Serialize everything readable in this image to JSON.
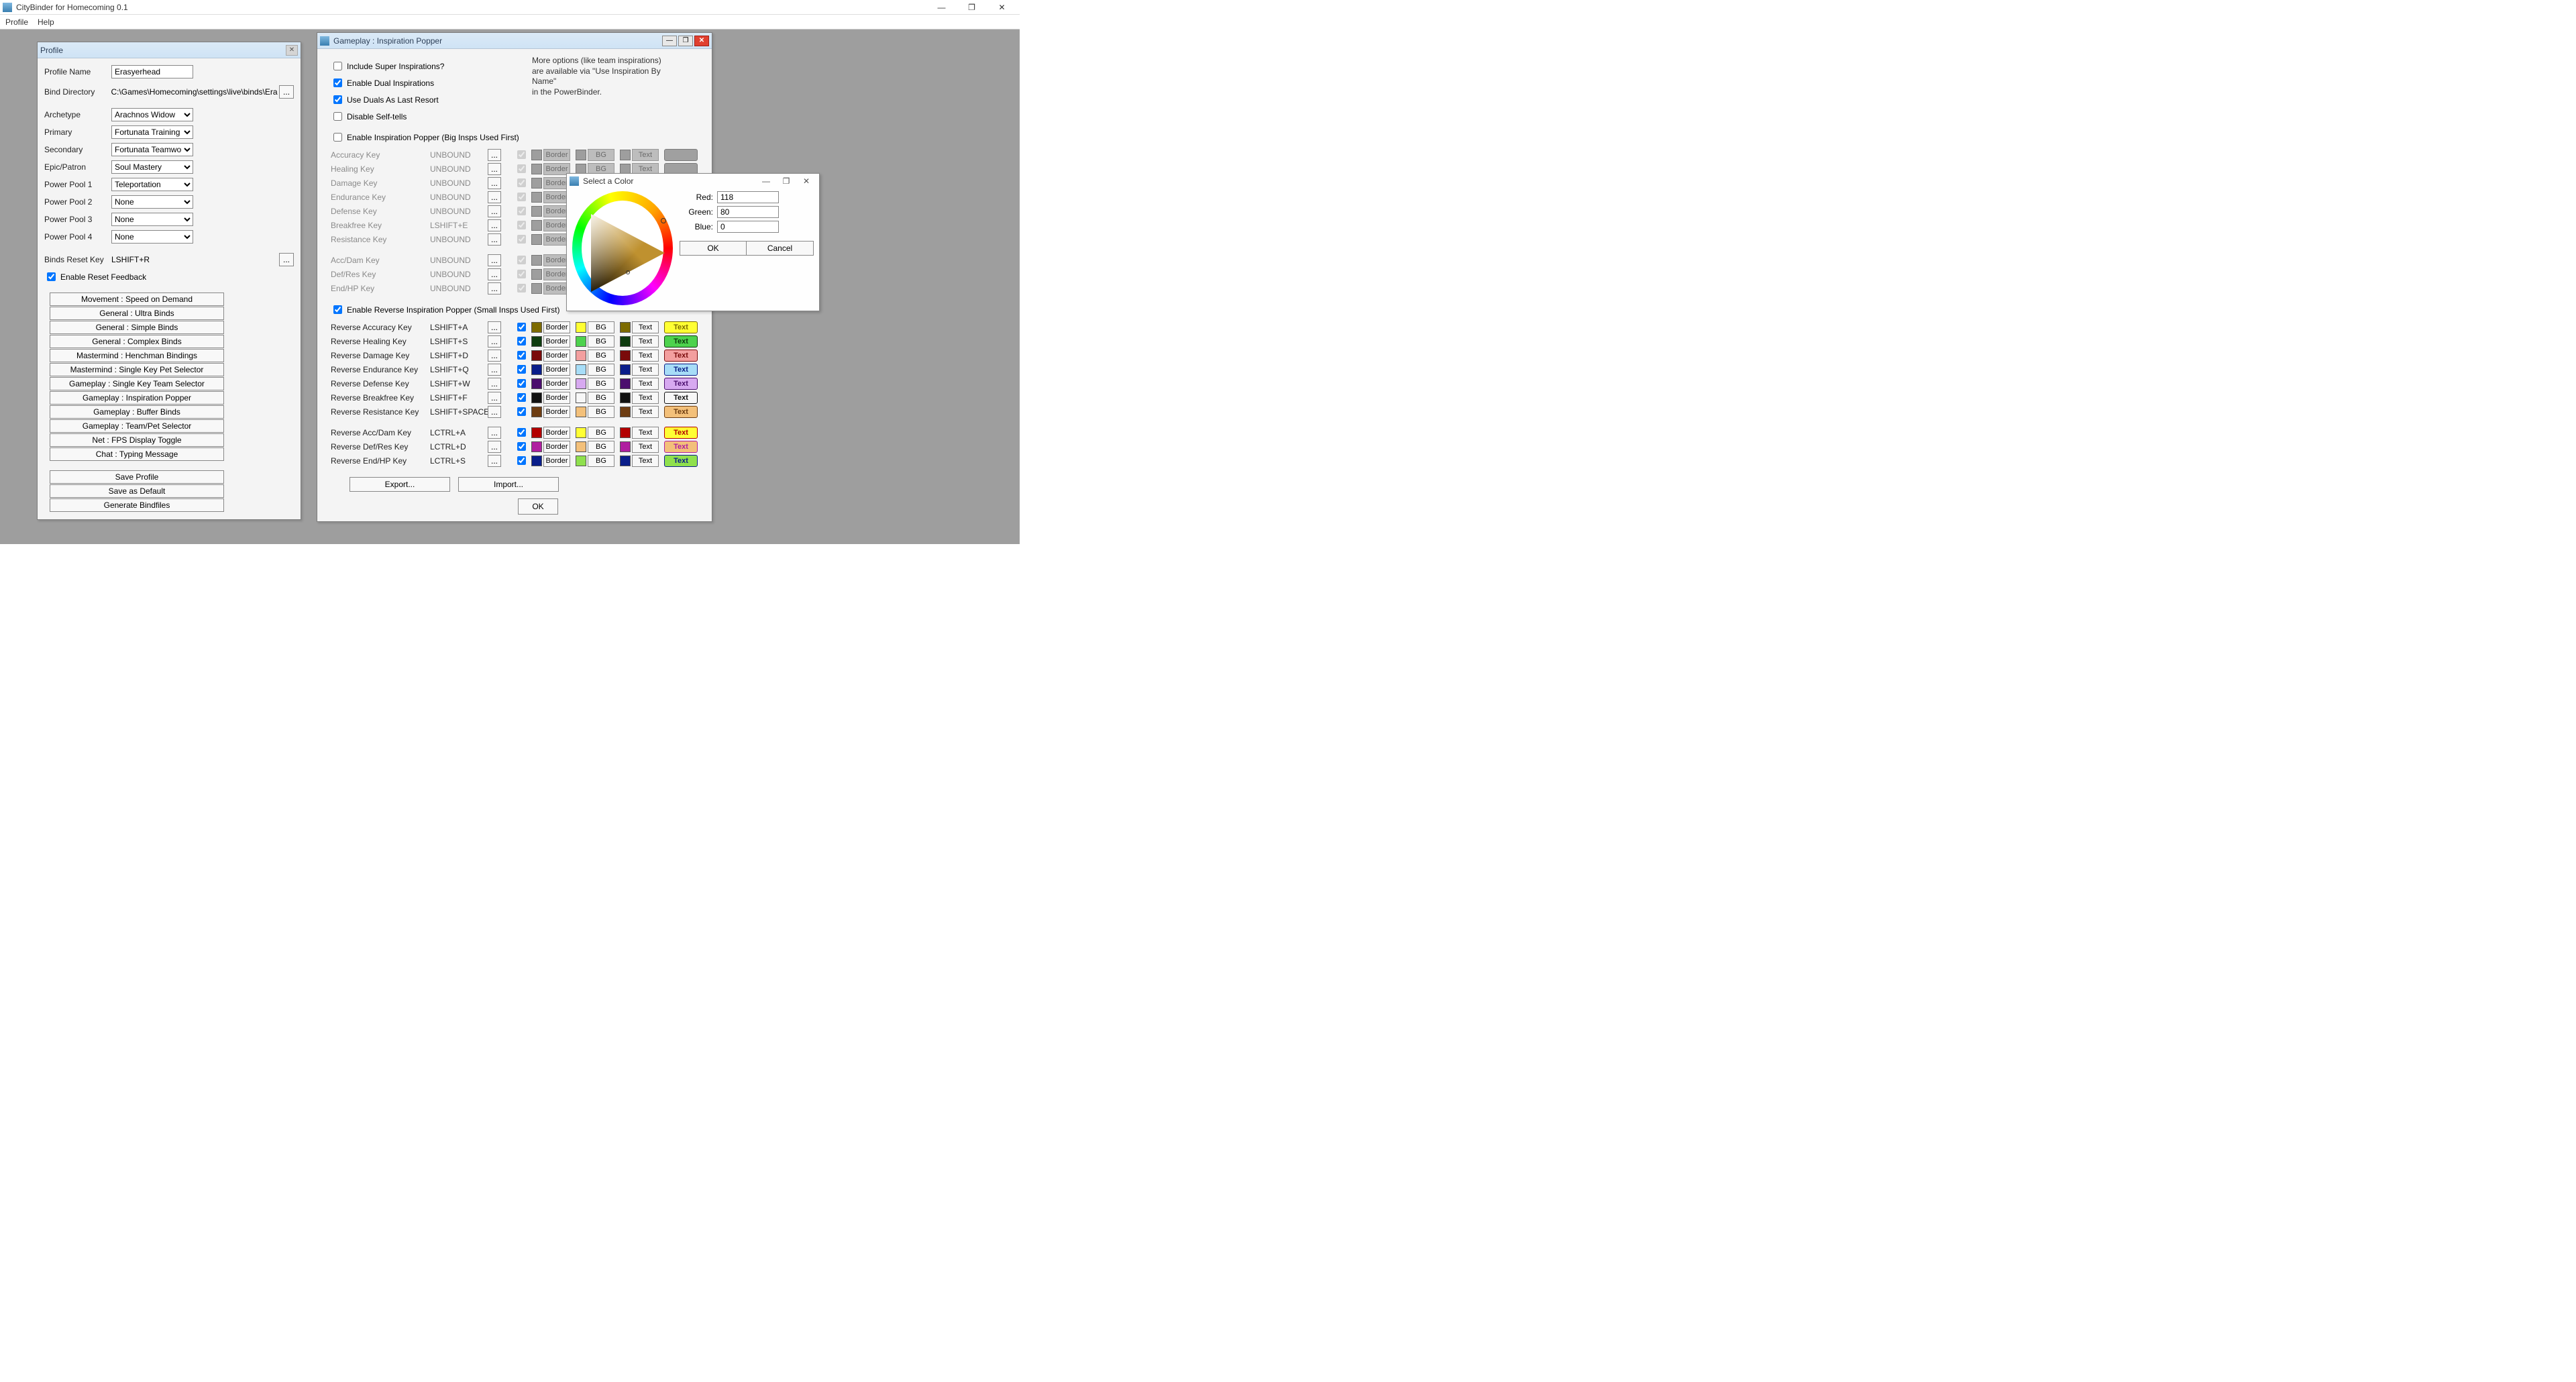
{
  "app": {
    "title": "CityBinder for Homecoming 0.1",
    "menu": [
      "Profile",
      "Help"
    ],
    "win_min": "—",
    "win_max": "❐",
    "win_close": "✕"
  },
  "profile": {
    "title": "Profile",
    "name_label": "Profile Name",
    "name_value": "Erasyerhead",
    "binddir_label": "Bind Directory",
    "binddir_value": "C:\\Games\\Homecoming\\settings\\live\\binds\\Erasyer",
    "ellipsis": "...",
    "dropdowns": [
      {
        "label": "Archetype",
        "value": "Arachnos Widow"
      },
      {
        "label": "Primary",
        "value": "Fortunata Training"
      },
      {
        "label": "Secondary",
        "value": "Fortunata Teamwork"
      },
      {
        "label": "Epic/Patron",
        "value": "Soul Mastery"
      },
      {
        "label": "Power Pool 1",
        "value": "Teleportation"
      },
      {
        "label": "Power Pool 2",
        "value": "None"
      },
      {
        "label": "Power Pool 3",
        "value": "None"
      },
      {
        "label": "Power Pool 4",
        "value": "None"
      }
    ],
    "reset_label": "Binds Reset Key",
    "reset_val": "LSHIFT+R",
    "reset_fb": "Enable Reset Feedback",
    "modules": [
      "Movement : Speed on Demand",
      "General : Ultra Binds",
      "General : Simple Binds",
      "General : Complex Binds",
      "Mastermind : Henchman Bindings",
      "Mastermind : Single Key Pet Selector",
      "Gameplay : Single Key Team Selector",
      "Gameplay : Inspiration Popper",
      "Gameplay : Buffer Binds",
      "Gameplay : Team/Pet Selector",
      "Net : FPS Display Toggle",
      "Chat : Typing Message"
    ],
    "actions": [
      "Save Profile",
      "Save as Default",
      "Generate Bindfiles"
    ]
  },
  "gameplay": {
    "title": "Gameplay : Inspiration Popper",
    "opts": [
      {
        "label": "Include Super Inspirations?",
        "checked": false
      },
      {
        "label": "Enable Dual Inspirations",
        "checked": true
      },
      {
        "label": "Use Duals As Last Resort",
        "checked": true
      },
      {
        "label": "Disable Self-tells",
        "checked": false
      }
    ],
    "more1": "More options (like team inspirations)",
    "more2": "are available via \"Use Inspiration By Name\"",
    "more3": "in the PowerBinder.",
    "enable_popper": "Enable Inspiration Popper (Big Insps Used First)",
    "enable_reverse": "Enable Reverse Inspiration Popper (Small Insps Used First)",
    "border_label": "Border",
    "bg_label": "BG",
    "text_label": "Text",
    "preview_text": "Text",
    "ellipsis": "...",
    "disabled_rows": [
      {
        "label": "Accuracy Key",
        "val": "UNBOUND"
      },
      {
        "label": "Healing Key",
        "val": "UNBOUND"
      },
      {
        "label": "Damage Key",
        "val": "UNBOUND"
      },
      {
        "label": "Endurance Key",
        "val": "UNBOUND"
      },
      {
        "label": "Defense Key",
        "val": "UNBOUND"
      },
      {
        "label": "Breakfree Key",
        "val": "LSHIFT+E"
      },
      {
        "label": "Resistance Key",
        "val": "UNBOUND"
      }
    ],
    "disabled_rows_b": [
      {
        "label": "Acc/Dam Key",
        "val": "UNBOUND"
      },
      {
        "label": "Def/Res Key",
        "val": "UNBOUND"
      },
      {
        "label": "End/HP Key",
        "val": "UNBOUND"
      }
    ],
    "rev_rows": [
      {
        "label": "Reverse Accuracy Key",
        "val": "LSHIFT+A",
        "bd": "#7d6b00",
        "bg": "#ffff33",
        "tx": "#7d6b00",
        "pv_bg": "#ffff33",
        "pv_bd": "#7d6b00",
        "pv_tx": "#7d6b00"
      },
      {
        "label": "Reverse Healing Key",
        "val": "LSHIFT+S",
        "bd": "#0e3b0e",
        "bg": "#4dd24d",
        "tx": "#0e3b0e",
        "pv_bg": "#4dd24d",
        "pv_bd": "#0e3b0e",
        "pv_tx": "#0e3b0e"
      },
      {
        "label": "Reverse Damage Key",
        "val": "LSHIFT+D",
        "bd": "#7a0b0b",
        "bg": "#f39f9f",
        "tx": "#7a0b0b",
        "pv_bg": "#f39f9f",
        "pv_bd": "#7a0b0b",
        "pv_tx": "#7a0b0b"
      },
      {
        "label": "Reverse Endurance Key",
        "val": "LSHIFT+Q",
        "bd": "#0a1e8a",
        "bg": "#a7ddf7",
        "tx": "#0a1e8a",
        "pv_bg": "#a7ddf7",
        "pv_bd": "#0a1e8a",
        "pv_tx": "#0a1e8a"
      },
      {
        "label": "Reverse Defense Key",
        "val": "LSHIFT+W",
        "bd": "#4b0e6e",
        "bg": "#d7a9f0",
        "tx": "#4b0e6e",
        "pv_bg": "#d7a9f0",
        "pv_bd": "#4b0e6e",
        "pv_tx": "#4b0e6e"
      },
      {
        "label": "Reverse Breakfree Key",
        "val": "LSHIFT+F",
        "bd": "#111111",
        "bg": "#f7f7f7",
        "tx": "#111111",
        "pv_bg": "#f7f7f7",
        "pv_bd": "#111111",
        "pv_tx": "#111111"
      },
      {
        "label": "Reverse Resistance Key",
        "val": "LSHIFT+SPACE",
        "bd": "#6e3d12",
        "bg": "#f3c07a",
        "tx": "#6e3d12",
        "pv_bg": "#f3c07a",
        "pv_bd": "#6e3d12",
        "pv_tx": "#6e3d12"
      }
    ],
    "rev_rows_b": [
      {
        "label": "Reverse Acc/Dam Key",
        "val": "LCTRL+A",
        "bd": "#b30000",
        "bg": "#ffff33",
        "tx": "#b30000",
        "pv_bg": "#ffff33",
        "pv_bd": "#b30000",
        "pv_tx": "#b30000"
      },
      {
        "label": "Reverse Def/Res Key",
        "val": "LCTRL+D",
        "bd": "#b01fa0",
        "bg": "#f3c07a",
        "tx": "#b01fa0",
        "pv_bg": "#f3c07a",
        "pv_bd": "#b01fa0",
        "pv_tx": "#b01fa0"
      },
      {
        "label": "Reverse End/HP Key",
        "val": "LCTRL+S",
        "bd": "#0a1e8a",
        "bg": "#8fe04d",
        "tx": "#0a1e8a",
        "pv_bg": "#8fe04d",
        "pv_bd": "#0a1e8a",
        "pv_tx": "#0a1e8a"
      }
    ],
    "export": "Export...",
    "import": "Import...",
    "ok": "OK"
  },
  "colorpicker": {
    "title": "Select a Color",
    "red_l": "Red:",
    "red_v": "118",
    "green_l": "Green:",
    "green_v": "80",
    "blue_l": "Blue:",
    "blue_v": "0",
    "ok": "OK",
    "cancel": "Cancel",
    "min": "—",
    "max": "❐",
    "close": "✕"
  }
}
